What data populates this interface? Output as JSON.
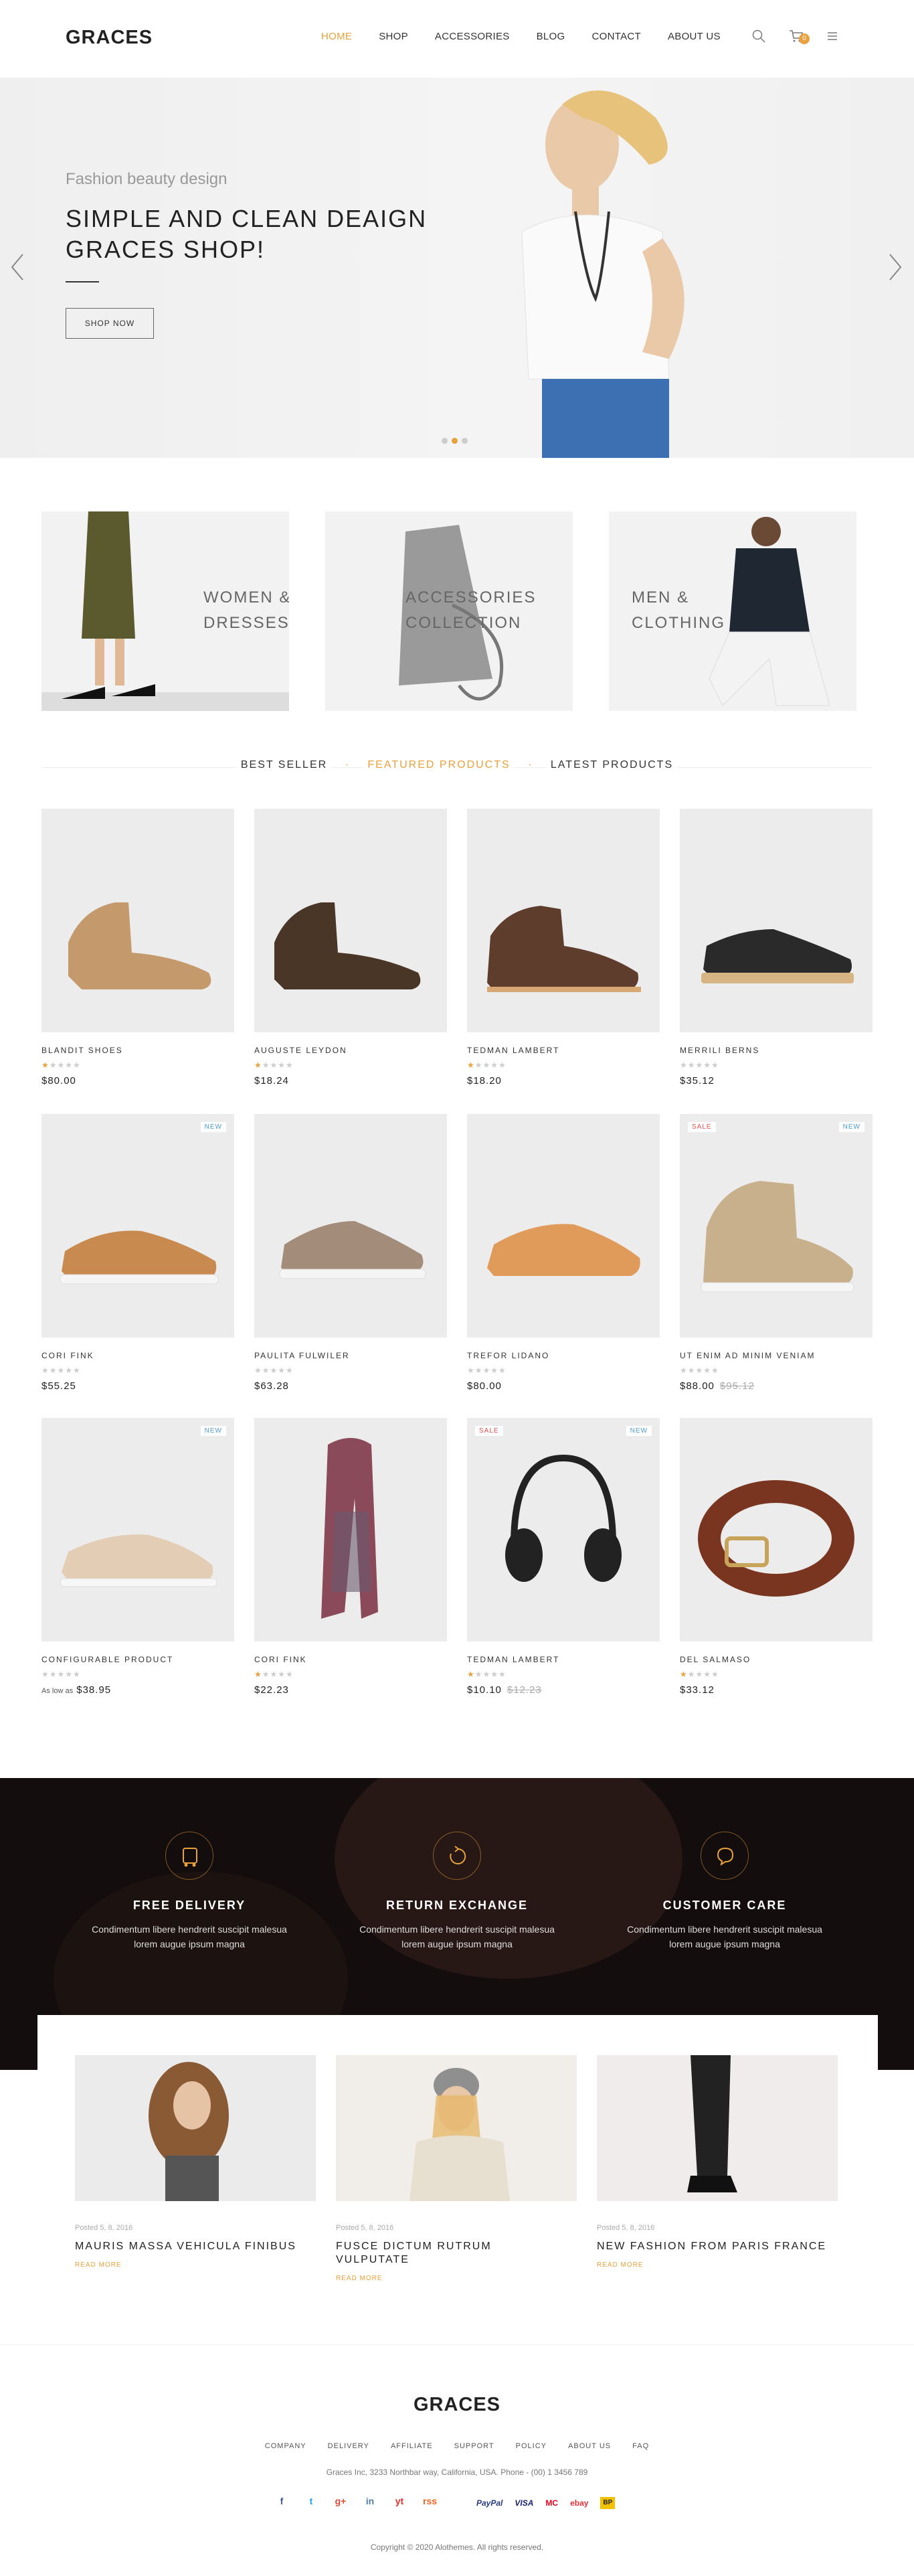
{
  "header": {
    "logo": "GRACES",
    "nav": [
      "HOME",
      "SHOP",
      "ACCESSORIES",
      "BLOG",
      "CONTACT",
      "ABOUT US"
    ],
    "cart_count": "0",
    "colors": {
      "accent": "#e8a13c"
    }
  },
  "hero": {
    "subtitle": "Fashion beauty design",
    "title_line1": "SIMPLE AND CLEAN DEAIGN",
    "title_line2": "GRACES SHOP!",
    "button": "SHOP NOW"
  },
  "categories": [
    {
      "line1": "WOMEN &",
      "line2": "DRESSESS"
    },
    {
      "line1": "ACCESSORIES",
      "line2": "COLLECTION"
    },
    {
      "line1": "MEN &",
      "line2": "CLOTHING"
    }
  ],
  "tabs": {
    "best": "BEST SELLER",
    "featured": "FEATURED PRODUCTS",
    "latest": "LATEST PRODUCTS"
  },
  "products": [
    {
      "name": "BLANDIT SHOES",
      "price": "$80.00",
      "rating": 1
    },
    {
      "name": "AUGUSTE LEYDON",
      "price": "$18.24",
      "rating": 1
    },
    {
      "name": "TEDMAN LAMBERT",
      "price": "$18.20",
      "rating": 1
    },
    {
      "name": "MERRILI BERNS",
      "price": "$35.12",
      "rating": 0
    },
    {
      "name": "CORI FINK",
      "price": "$55.25",
      "rating": 0,
      "badge_new": "NEW"
    },
    {
      "name": "PAULITA FULWILER",
      "price": "$63.28",
      "rating": 0
    },
    {
      "name": "TREFOR LIDANO",
      "price": "$80.00",
      "rating": 0
    },
    {
      "name": "UT ENIM AD MINIM VENIAM",
      "price": "$88.00",
      "old_price": "$95.12",
      "rating": 0,
      "badge_new": "NEW",
      "badge_sale": "SALE"
    },
    {
      "name": "CONFIGURABLE PRODUCT",
      "as_low_as": "As low as",
      "price": "$38.95",
      "rating": 0,
      "badge_new": "NEW"
    },
    {
      "name": "CORI FINK",
      "price": "$22.23",
      "rating": 1
    },
    {
      "name": "TEDMAN LAMBERT",
      "price": "$10.10",
      "old_price": "$12.23",
      "rating": 1,
      "badge_new": "NEW",
      "badge_sale": "SALE"
    },
    {
      "name": "DEL SALMASO",
      "price": "$33.12",
      "rating": 1
    }
  ],
  "features": [
    {
      "title": "FREE DELIVERY",
      "text1": "Condimentum libere hendrerit suscipit malesua",
      "text2": "lorem augue ipsum magna",
      "icon": "truck-icon"
    },
    {
      "title": "RETURN EXCHANGE",
      "text1": "Condimentum libere hendrerit suscipit malesua",
      "text2": "lorem augue ipsum magna",
      "icon": "return-icon"
    },
    {
      "title": "CUSTOMER CARE",
      "text1": "Condimentum libere hendrerit suscipit malesua",
      "text2": "lorem augue ipsum magna",
      "icon": "chat-icon"
    }
  ],
  "posts": [
    {
      "date": "Posted 5, 8, 2016",
      "title": "MAURIS MASSA VEHICULA FINIBUS",
      "title2": "",
      "more": "READ MORE"
    },
    {
      "date": "Posted 5, 8, 2016",
      "title": "FUSCE DICTUM RUTRUM",
      "title2": "VULPUTATE",
      "more": "READ MORE"
    },
    {
      "date": "Posted 5, 8, 2016",
      "title": "NEW FASHION FROM PARIS FRANCE",
      "title2": "",
      "more": "READ MORE"
    }
  ],
  "footer": {
    "logo": "GRACES",
    "links": [
      "COMPANY",
      "DELIVERY",
      "AFFILIATE",
      "SUPPORT",
      "POLICY",
      "ABOUT US",
      "FAQ"
    ],
    "address": "Graces Inc, 3233 Northbar way, California, USA. Phone - (00) 1 3456 789",
    "social": [
      "f",
      "t",
      "g+",
      "in",
      "yt",
      "rss"
    ],
    "payments": [
      "PayPal",
      "VISA",
      "MC",
      "ebay",
      "BP"
    ],
    "copyright": "Copyright © 2020 Alothemes. All rights reserved."
  }
}
